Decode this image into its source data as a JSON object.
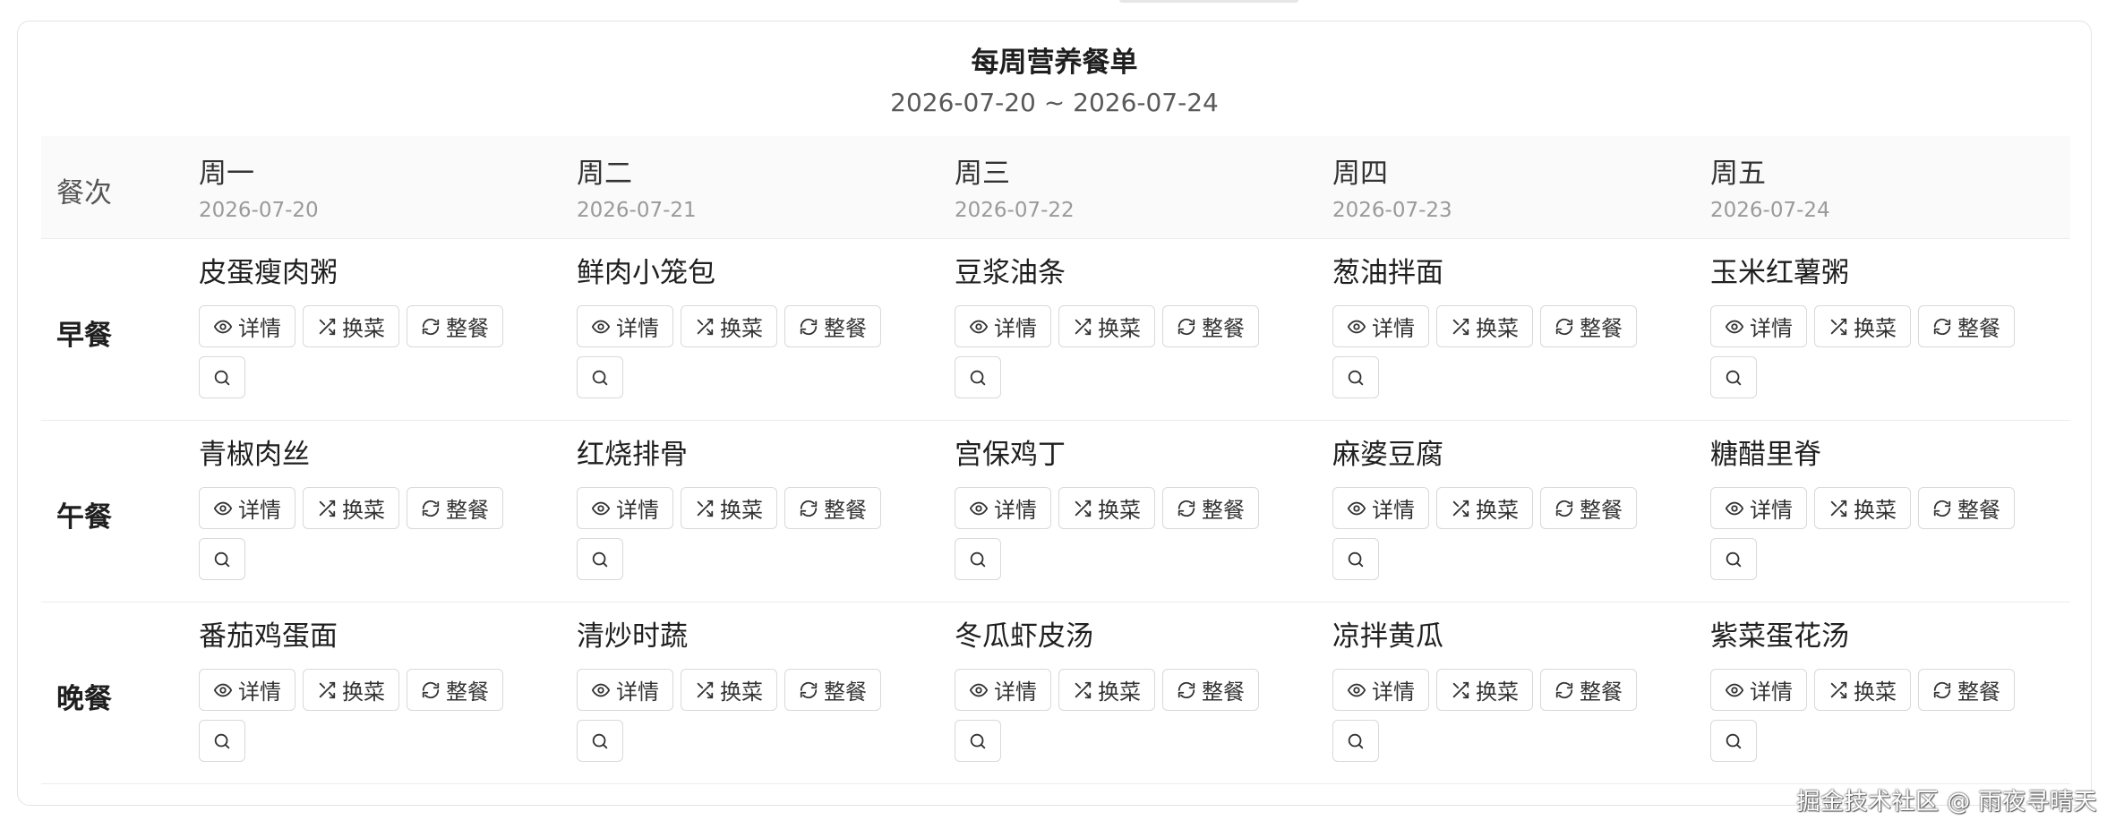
{
  "header": {
    "title": "每周营养餐单",
    "date_range": "2026-07-20 ~ 2026-07-24"
  },
  "table": {
    "meal_column_header": "餐次",
    "days": [
      {
        "name": "周一",
        "date": "2026-07-20"
      },
      {
        "name": "周二",
        "date": "2026-07-21"
      },
      {
        "name": "周三",
        "date": "2026-07-22"
      },
      {
        "name": "周四",
        "date": "2026-07-23"
      },
      {
        "name": "周五",
        "date": "2026-07-24"
      }
    ],
    "meals": [
      {
        "label": "早餐",
        "dishes": [
          "皮蛋瘦肉粥",
          "鲜肉小笼包",
          "豆浆油条",
          "葱油拌面",
          "玉米红薯粥"
        ]
      },
      {
        "label": "午餐",
        "dishes": [
          "青椒肉丝",
          "红烧排骨",
          "宫保鸡丁",
          "麻婆豆腐",
          "糖醋里脊"
        ]
      },
      {
        "label": "晚餐",
        "dishes": [
          "番茄鸡蛋面",
          "清炒时蔬",
          "冬瓜虾皮汤",
          "凉拌黄瓜",
          "紫菜蛋花汤"
        ]
      }
    ]
  },
  "actions": {
    "detail_label": "详情",
    "swap_dish_label": "换菜",
    "whole_meal_label": "整餐",
    "detail_icon": "eye-icon",
    "swap_icon": "shuffle-icon",
    "whole_meal_icon": "refresh-icon",
    "search_icon": "search-icon"
  },
  "watermark": "掘金技术社区 @ 雨夜寻晴天"
}
